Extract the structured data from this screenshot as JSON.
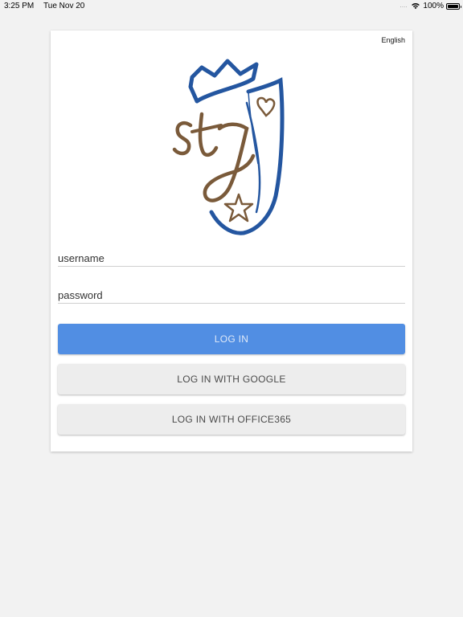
{
  "status_bar": {
    "time": "3:25 PM",
    "date": "Tue Nov 20",
    "signal_dots": "....",
    "battery": "100%"
  },
  "header": {
    "language": "English"
  },
  "logo": {
    "text": "stj",
    "colors": {
      "shield": "#2456a0",
      "script": "#7a5a3a"
    }
  },
  "form": {
    "username_placeholder": "username",
    "password_placeholder": "password",
    "login_label": "LOG IN",
    "google_label": "LOG IN WITH GOOGLE",
    "office_label": "LOG IN WITH OFFICE365"
  },
  "colors": {
    "primary": "#518ee3",
    "secondary": "#ededed",
    "background": "#f2f2f2"
  }
}
